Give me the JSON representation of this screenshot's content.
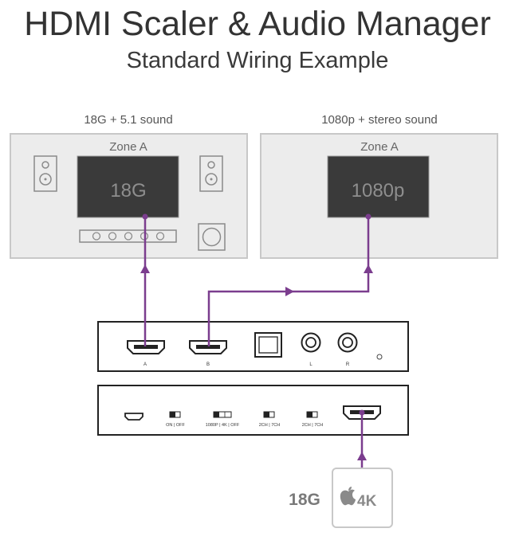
{
  "header": {
    "title": "HDMI Scaler & Audio Manager",
    "subtitle": "Standard Wiring Example"
  },
  "zones": [
    {
      "caption": "18G + 5.1 sound",
      "zone_label": "Zone A",
      "screen_text": "18G"
    },
    {
      "caption": "1080p + stereo sound",
      "zone_label": "Zone A",
      "screen_text": "1080p"
    }
  ],
  "device_front": {
    "port_labels": [
      "A",
      "B",
      "L",
      "R"
    ]
  },
  "device_back": {
    "switch_labels": [
      "ON | OFF",
      "1080P | 4K | OFF",
      "2CH | 7CH",
      "2CH | 7CH"
    ]
  },
  "source": {
    "signal_label": "18G",
    "device_label": "4K",
    "logo": "apple-logo"
  },
  "colors": {
    "cable": "#7b3d8e",
    "zone_fill": "#ececec",
    "zone_border": "#c8c8c8",
    "screen": "#3a3a3a",
    "device_border": "#222222"
  }
}
